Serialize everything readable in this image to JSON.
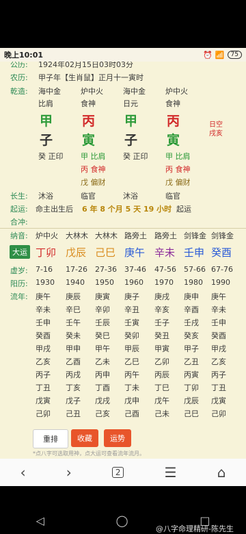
{
  "status": {
    "time": "晚上10:01",
    "battery": "75"
  },
  "rows": {
    "gongli_label": "公历:",
    "gongli_value": "1924年02月15日03时03分",
    "nongli_label": "农历:",
    "nongli_value": "甲子年【生肖鼠】正月十一寅时",
    "qianzao_label": "乾造:",
    "pillar_nayin": [
      "海中金",
      "炉中火",
      "海中金",
      "炉中火"
    ],
    "pillar_shishen": [
      "比肩",
      "食神",
      "日元",
      "食神"
    ],
    "pillar_gan": [
      "甲",
      "丙",
      "甲",
      "丙"
    ],
    "pillar_zhi": [
      "子",
      "寅",
      "子",
      "寅"
    ],
    "hidden_a": [
      "癸 正印",
      "甲 比肩",
      "癸 正印",
      "甲 比肩"
    ],
    "hidden_b": [
      "丙 食神",
      "丙 食神"
    ],
    "hidden_c": [
      "戊 偏财",
      "戊 偏财"
    ],
    "rikong": "日空\n戌亥",
    "changsheng_label": "长生:",
    "changsheng": [
      "沐浴",
      "临官",
      "沐浴",
      "临官"
    ],
    "qiyun_label": "起运:",
    "qiyun_prefix": "命主出生后",
    "qiyun_bold": "6 年 8 个月 5 天 19 小时",
    "qiyun_suffix": "起运",
    "hechong_label": "合冲:",
    "nayin_label": "纳音:",
    "nayin": [
      "炉中火",
      "大林木",
      "大林木",
      "路旁土",
      "路旁土",
      "剑锋金",
      "剑锋金"
    ],
    "dayun_badge": "大运",
    "dayun": [
      "丁卯",
      "戊辰",
      "己巳",
      "庚午",
      "辛未",
      "壬申",
      "癸酉"
    ],
    "xusui_label": "虚岁:",
    "xusui": [
      "7-16",
      "17-26",
      "27-36",
      "37-46",
      "47-56",
      "57-66",
      "67-76"
    ],
    "yangli_label": "阳历:",
    "yangli": [
      "1930",
      "1940",
      "1950",
      "1960",
      "1970",
      "1980",
      "1990"
    ],
    "liunian_label": "流年:",
    "liunian": [
      [
        "庚午",
        "庚辰",
        "庚寅",
        "庚子",
        "庚戌",
        "庚申",
        "庚午"
      ],
      [
        "辛未",
        "辛巳",
        "辛卯",
        "辛丑",
        "辛亥",
        "辛酉",
        "辛未"
      ],
      [
        "壬申",
        "壬午",
        "壬辰",
        "壬寅",
        "壬子",
        "壬戌",
        "壬申"
      ],
      [
        "癸酉",
        "癸未",
        "癸巳",
        "癸卯",
        "癸丑",
        "癸亥",
        "癸酉"
      ],
      [
        "甲戌",
        "甲申",
        "甲午",
        "甲辰",
        "甲寅",
        "甲子",
        "甲戌"
      ],
      [
        "乙亥",
        "乙酉",
        "乙未",
        "乙巳",
        "乙卯",
        "乙丑",
        "乙亥"
      ],
      [
        "丙子",
        "丙戌",
        "丙申",
        "丙午",
        "丙辰",
        "丙寅",
        "丙子"
      ],
      [
        "丁丑",
        "丁亥",
        "丁酉",
        "丁未",
        "丁巳",
        "丁卯",
        "丁丑"
      ],
      [
        "戊寅",
        "戊子",
        "戊戌",
        "戊申",
        "戊午",
        "戊辰",
        "戊寅"
      ],
      [
        "己卯",
        "己丑",
        "己亥",
        "己酉",
        "己未",
        "己巳",
        "己卯"
      ]
    ],
    "footnote": "*点八字可选取用神，点大运可查看流年流月。"
  },
  "buttons": {
    "reset": "重排",
    "save": "收藏",
    "fortune": "运势"
  },
  "nav": {
    "page_count": "2"
  },
  "watermark": "@八字命理精研-陈先生"
}
